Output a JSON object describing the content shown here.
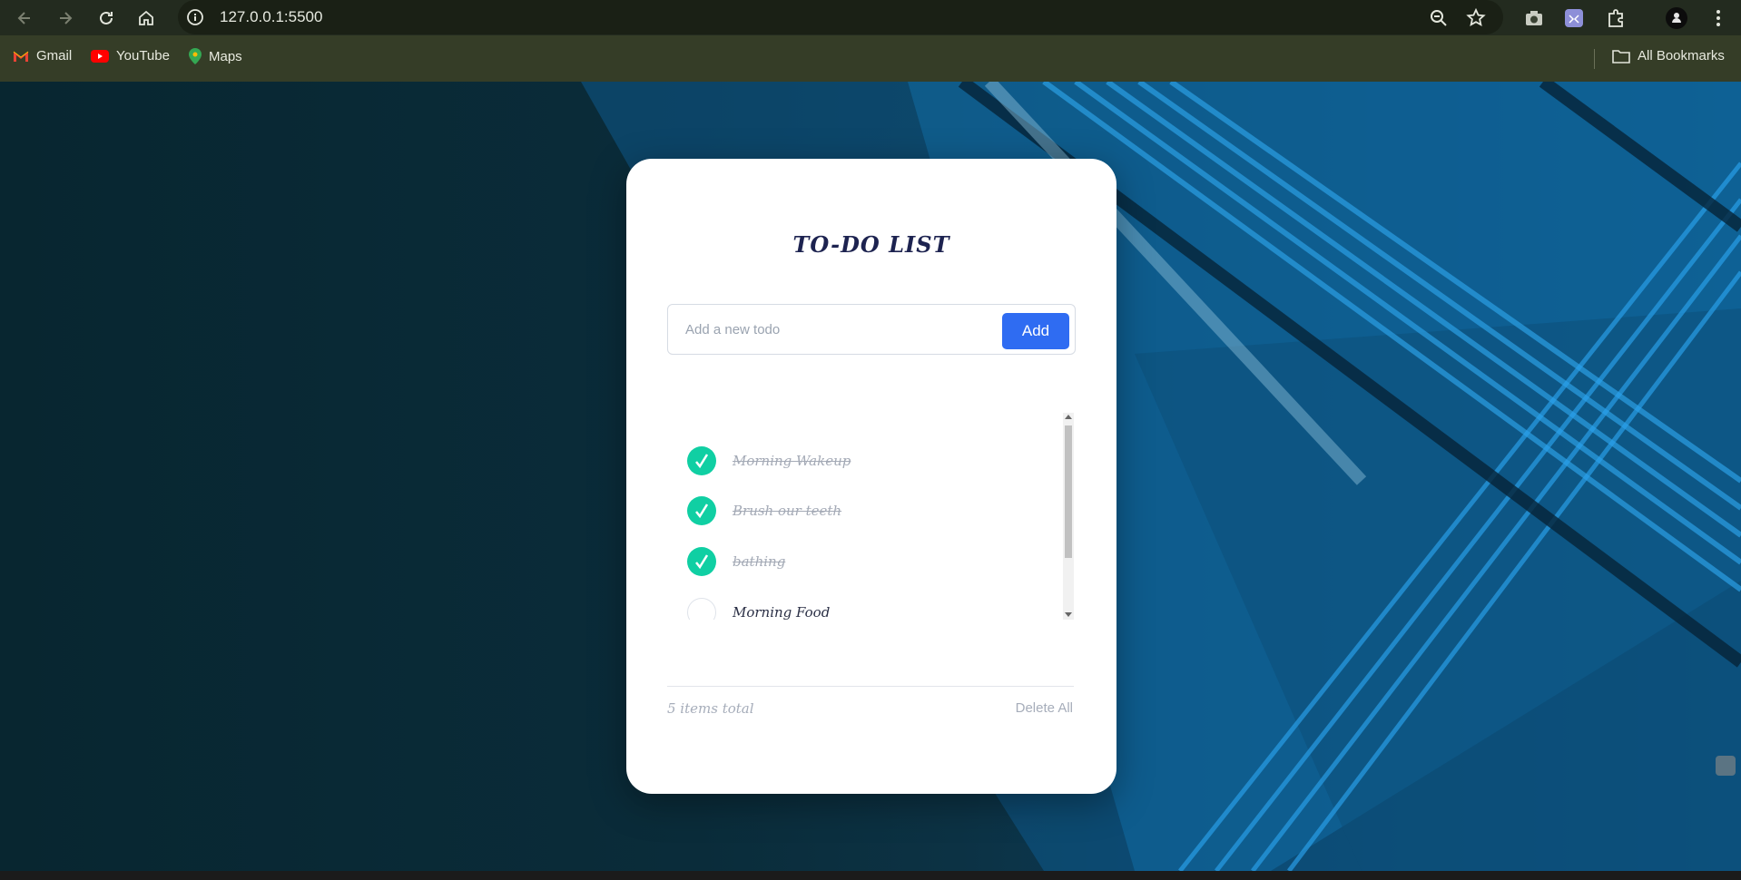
{
  "browser": {
    "url": "127.0.0.1:5500",
    "bookmarks": [
      {
        "label": "Gmail",
        "icon": "gmail-icon"
      },
      {
        "label": "YouTube",
        "icon": "youtube-icon"
      },
      {
        "label": "Maps",
        "icon": "maps-icon"
      }
    ],
    "all_bookmarks_label": "All Bookmarks"
  },
  "app": {
    "title": "TO-DO LIST",
    "input_placeholder": "Add a new todo",
    "input_value": "",
    "add_label": "Add",
    "todos": [
      {
        "text": "Morning Wakeup",
        "done": true
      },
      {
        "text": "Brush our teeth",
        "done": true
      },
      {
        "text": "bathing",
        "done": true
      },
      {
        "text": "Morning Food",
        "done": false
      }
    ],
    "count_label": "5 items total",
    "delete_all_label": "Delete All"
  },
  "colors": {
    "accent_button": "#2f6cf2",
    "check_done": "#10cfa3",
    "title_text": "#1d2350"
  }
}
